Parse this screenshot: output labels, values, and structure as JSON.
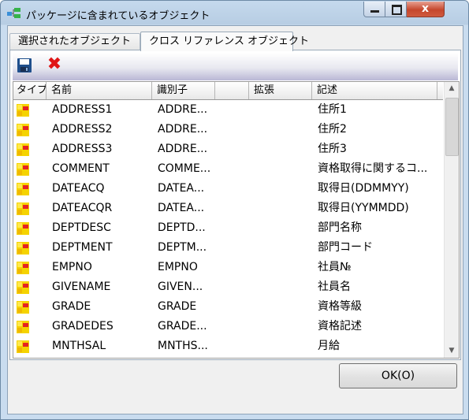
{
  "window": {
    "title": "パッケージに含まれているオブジェクト",
    "close_glyph": "x"
  },
  "tabs": [
    {
      "label": "選択されたオブジェクト",
      "selected": false
    },
    {
      "label": "クロス リファレンス オブジェクト",
      "selected": true
    }
  ],
  "toolbar": {
    "save_icon": "save-icon",
    "delete_icon": "delete-icon",
    "delete_glyph": "✖"
  },
  "grid": {
    "headers": [
      "タイプ",
      "名前",
      "識別子",
      "",
      "拡張",
      "記述"
    ],
    "rows": [
      {
        "name": "ADDRESS1",
        "id": "ADDRE...",
        "ext": "",
        "desc": "住所1"
      },
      {
        "name": "ADDRESS2",
        "id": "ADDRE...",
        "ext": "",
        "desc": "住所2"
      },
      {
        "name": "ADDRESS3",
        "id": "ADDRE...",
        "ext": "",
        "desc": "住所3"
      },
      {
        "name": "COMMENT",
        "id": "COMME...",
        "ext": "",
        "desc": "資格取得に関するコ..."
      },
      {
        "name": "DATEACQ",
        "id": "DATEA...",
        "ext": "",
        "desc": "取得日(DDMMYY)"
      },
      {
        "name": "DATEACQR",
        "id": "DATEA...",
        "ext": "",
        "desc": "取得日(YYMMDD)"
      },
      {
        "name": "DEPTDESC",
        "id": "DEPTD...",
        "ext": "",
        "desc": "部門名称"
      },
      {
        "name": "DEPTMENT",
        "id": "DEPTM...",
        "ext": "",
        "desc": "部門コード"
      },
      {
        "name": "EMPNO",
        "id": "EMPNO",
        "ext": "",
        "desc": "社員№"
      },
      {
        "name": "GIVENAME",
        "id": "GIVEN...",
        "ext": "",
        "desc": "社員名"
      },
      {
        "name": "GRADE",
        "id": "GRADE",
        "ext": "",
        "desc": "資格等級"
      },
      {
        "name": "GRADEDES",
        "id": "GRADE...",
        "ext": "",
        "desc": "資格記述"
      },
      {
        "name": "MNTHSAL",
        "id": "MNTHS...",
        "ext": "",
        "desc": "月給"
      }
    ],
    "scroll_up": "▲",
    "scroll_down": "▼"
  },
  "buttons": {
    "ok_label": "OK(O)"
  }
}
